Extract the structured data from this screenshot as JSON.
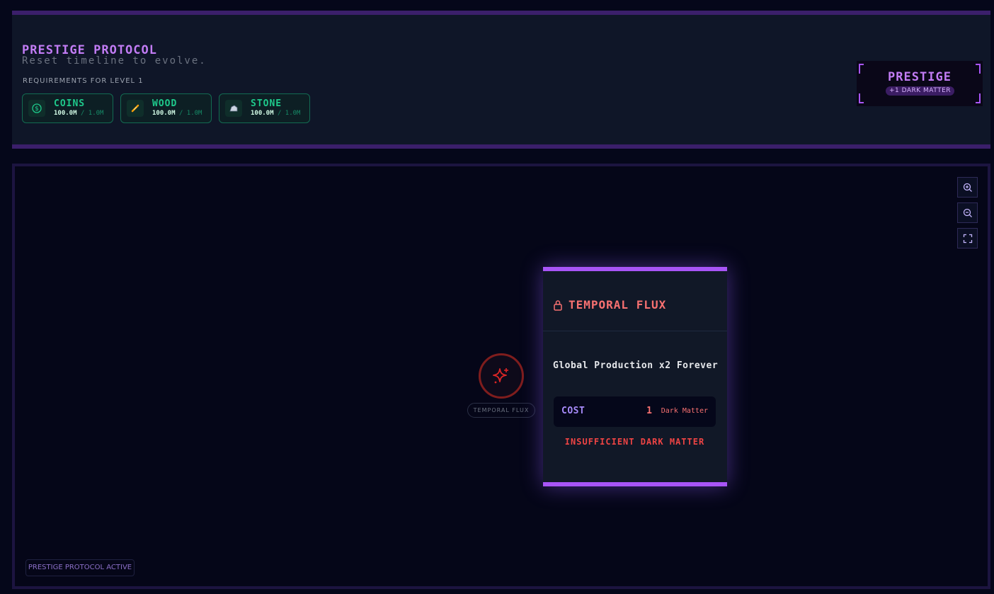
{
  "header": {
    "title": "PRESTIGE PROTOCOL",
    "subtitle": "Reset timeline to evolve.",
    "requirements_label": "REQUIREMENTS FOR LEVEL 1",
    "resources": [
      {
        "name": "COINS",
        "current": "100.0M",
        "separator": "/",
        "required": "1.0M",
        "icon": "dollar-coin-icon"
      },
      {
        "name": "WOOD",
        "current": "100.0M",
        "separator": "/",
        "required": "1.0M",
        "icon": "wood-log-icon"
      },
      {
        "name": "STONE",
        "current": "100.0M",
        "separator": "/",
        "required": "1.0M",
        "icon": "stone-rock-icon"
      }
    ],
    "prestige_button": {
      "label": "PRESTIGE",
      "reward": "+1 DARK MATTER"
    }
  },
  "canvas": {
    "zoom_controls": [
      "zoom-in-icon",
      "zoom-out-icon",
      "fit-screen-icon"
    ],
    "node": {
      "label": "TEMPORAL FLUX",
      "icon": "sparkle-icon",
      "status": "locked"
    },
    "status_badge": "PRESTIGE PROTOCOL ACTIVE"
  },
  "upgrade_card": {
    "title": "TEMPORAL FLUX",
    "description": "Global Production x2 Forever",
    "cost_label": "COST",
    "cost_value": "1",
    "cost_unit": "Dark Matter",
    "warning": "INSUFFICIENT DARK MATTER"
  },
  "colors": {
    "accent": "#a855f7",
    "title": "#c27cf5",
    "resource_green": "#1ec98b",
    "danger": "#ef4444",
    "background": "#05071a"
  }
}
